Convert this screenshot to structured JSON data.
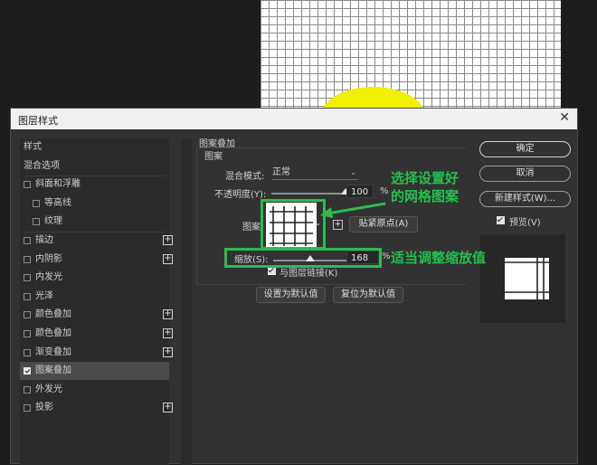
{
  "window": {
    "title": "图层样式",
    "close_glyph": "✕"
  },
  "left_panel": {
    "items": [
      {
        "label": "样式",
        "checkbox": false,
        "checked": false,
        "plus": false,
        "indent": 0,
        "selected": false
      },
      {
        "label": "混合选项",
        "checkbox": false,
        "checked": false,
        "plus": false,
        "indent": 0,
        "selected": false
      },
      {
        "label": "斜面和浮雕",
        "checkbox": true,
        "checked": false,
        "plus": false,
        "indent": 0,
        "selected": false
      },
      {
        "label": "等高线",
        "checkbox": true,
        "checked": false,
        "plus": false,
        "indent": 1,
        "selected": false
      },
      {
        "label": "纹理",
        "checkbox": true,
        "checked": false,
        "plus": false,
        "indent": 1,
        "selected": false
      },
      {
        "label": "描边",
        "checkbox": true,
        "checked": false,
        "plus": true,
        "indent": 0,
        "selected": false
      },
      {
        "label": "内阴影",
        "checkbox": true,
        "checked": false,
        "plus": true,
        "indent": 0,
        "selected": false
      },
      {
        "label": "内发光",
        "checkbox": true,
        "checked": false,
        "plus": false,
        "indent": 0,
        "selected": false
      },
      {
        "label": "光泽",
        "checkbox": true,
        "checked": false,
        "plus": false,
        "indent": 0,
        "selected": false
      },
      {
        "label": "颜色叠加",
        "checkbox": true,
        "checked": false,
        "plus": true,
        "indent": 0,
        "selected": false
      },
      {
        "label": "颜色叠加",
        "checkbox": true,
        "checked": false,
        "plus": true,
        "indent": 0,
        "selected": false
      },
      {
        "label": "渐变叠加",
        "checkbox": true,
        "checked": false,
        "plus": true,
        "indent": 0,
        "selected": false
      },
      {
        "label": "图案叠加",
        "checkbox": true,
        "checked": true,
        "plus": false,
        "indent": 0,
        "selected": true
      },
      {
        "label": "外发光",
        "checkbox": true,
        "checked": false,
        "plus": false,
        "indent": 0,
        "selected": false
      },
      {
        "label": "投影",
        "checkbox": true,
        "checked": false,
        "plus": true,
        "indent": 0,
        "selected": false
      }
    ],
    "plus_glyph": "+"
  },
  "pattern_overlay": {
    "section_title": "图案叠加",
    "group_title": "图案",
    "blend_mode_label": "混合模式:",
    "blend_mode_value": "正常",
    "opacity_label": "不透明度(Y):",
    "opacity_value": "100",
    "opacity_fraction": 1.0,
    "percent": "%",
    "pattern_label": "图案",
    "snap_origin_button": "贴紧原点(A)",
    "new_preset_glyph": "+",
    "scale_label": "缩放(S):",
    "scale_value": "168",
    "link_with_layer_label": "与图层链接(K)",
    "link_with_layer_checked": true,
    "make_default_button": "设置为默认值",
    "reset_default_button": "复位为默认值",
    "dropdown_glyph": "⌄"
  },
  "right_panel": {
    "ok_button": "确定",
    "cancel_button": "取消",
    "new_style_button": "新建样式(W)...",
    "preview_label": "预览(V)",
    "preview_checked": true
  },
  "annotations": {
    "pattern_note_line1": "选择设置好",
    "pattern_note_line2": "的网格图案",
    "scale_note": "适当调整缩放值"
  },
  "colors": {
    "annotation_green": "#2dbb4e",
    "canvas_yellow": "#f2ef00"
  }
}
